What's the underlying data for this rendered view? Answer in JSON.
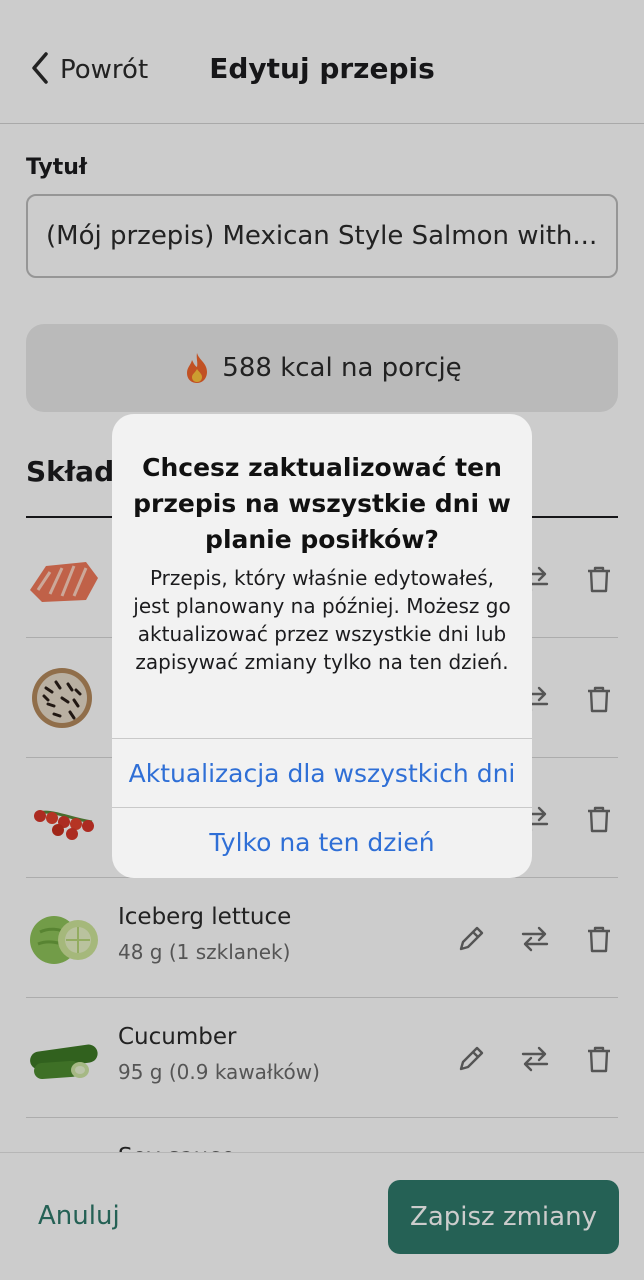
{
  "header": {
    "back_label": "Powrót",
    "title": "Edytuj przepis"
  },
  "form": {
    "title_label": "Tytuł",
    "title_value": "(Mój przepis) Mexican Style Salmon with...",
    "kcal_text": "588 kcal na porcję",
    "ingredients_heading": "Składniki"
  },
  "ingredients": [
    {
      "name": "",
      "amount": "",
      "icon": "salmon"
    },
    {
      "name": "",
      "amount": "",
      "icon": "wild-rice"
    },
    {
      "name": "",
      "amount": "",
      "icon": "cherry-tomatoes"
    },
    {
      "name": "Iceberg lettuce",
      "amount": "48 g (1 szklanek)",
      "icon": "lettuce"
    },
    {
      "name": "Cucumber",
      "amount": "95 g (0.9 kawałków)",
      "icon": "cucumber"
    },
    {
      "name": "Soy sauce",
      "amount": "",
      "icon": "soy-sauce"
    }
  ],
  "bottom": {
    "cancel_label": "Anuluj",
    "save_label": "Zapisz zmiany"
  },
  "alert": {
    "title": "Chcesz zaktualizować ten przepis na wszystkie dni w planie posiłków?",
    "message": "Przepis, który właśnie edytowałeś, jest planowany na później. Możesz go aktualizować przez wszystkie dni lub zapisywać zmiany tylko na ten dzień.",
    "button_all": "Aktualizacja dla wszystkich dni",
    "button_today": "Tylko na ten dzień"
  },
  "colors": {
    "accent": "#2f7a6b",
    "link_blue": "#2f6fd6"
  }
}
